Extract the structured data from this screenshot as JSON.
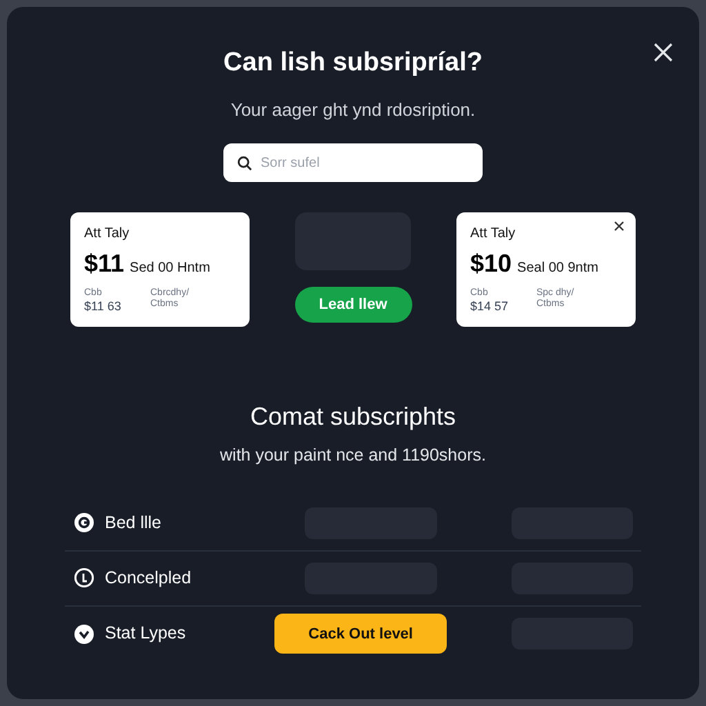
{
  "dialog": {
    "title": "Can lish subsripríal?",
    "subtitle": "Your aager ght ynd rdosription."
  },
  "search": {
    "placeholder": "Sorr sufel"
  },
  "plans": [
    {
      "name": "Att Taly",
      "price": "$11",
      "price_note": "Sed 00 Hntm",
      "label_1": "Cbb",
      "value_1": "$11 63",
      "label_2": "Cbrcdhy/",
      "value_2": "Ctbms",
      "closable": false
    },
    {
      "name": "Att Taly",
      "price": "$10",
      "price_note": "Seal 00 9ntm",
      "label_1": "Cbb",
      "value_1": "$14 57",
      "label_2": "Spc dhy/",
      "value_2": "Ctbms",
      "closable": true
    }
  ],
  "middle_button": "Lead llew",
  "section": {
    "title": "Comat subscriphts",
    "subtitle": "with your paint nce and 1190shors."
  },
  "rows": [
    {
      "label": "Bed llle",
      "kind": "g"
    },
    {
      "label": "Concelpled",
      "kind": "t"
    },
    {
      "label": "Stat Lypes",
      "kind": "v",
      "button": "Cack Out level"
    }
  ]
}
